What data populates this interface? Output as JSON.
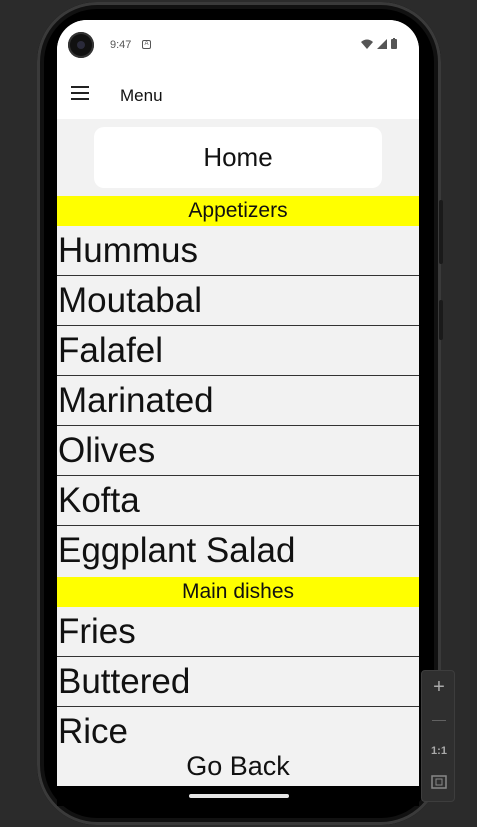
{
  "status_bar": {
    "time": "9:47",
    "notification_glyph": "A"
  },
  "app_bar": {
    "title": "Menu",
    "menu_icon": "hamburger-icon"
  },
  "home_button": {
    "label": "Home"
  },
  "sections": [
    {
      "title": "Appetizers",
      "items": [
        "Hummus",
        "Moutabal",
        "Falafel",
        "Marinated",
        "Olives",
        "Kofta",
        "Eggplant Salad"
      ]
    },
    {
      "title": "Main dishes",
      "items": [
        "Fries",
        "Buttered",
        "Rice"
      ]
    }
  ],
  "footer": {
    "go_back_label": "Go Back"
  },
  "emulator_controls": {
    "zoom_in": "+",
    "zoom_out": "—",
    "actual_size": "1:1"
  },
  "colors": {
    "section_header_bg": "#ffff00",
    "screen_bg": "#f2f2f2"
  }
}
